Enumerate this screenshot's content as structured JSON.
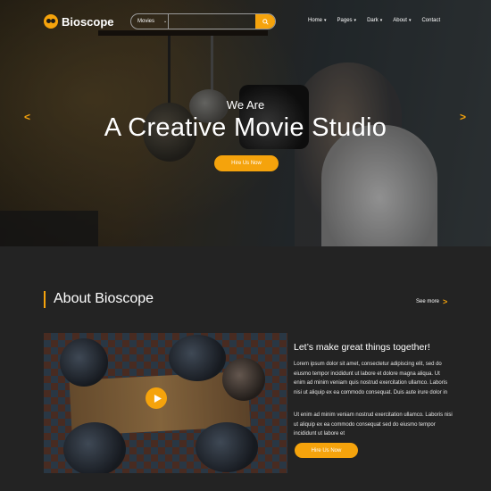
{
  "brand": {
    "name": "Bioscope",
    "logo_icon": "owl-eyes-icon",
    "accent": "#f5a30c"
  },
  "search": {
    "category": "Movies",
    "placeholder": "",
    "button_icon": "search-icon"
  },
  "nav": {
    "items": [
      {
        "label": "Home",
        "has_dropdown": true
      },
      {
        "label": "Pages",
        "has_dropdown": true
      },
      {
        "label": "Dark",
        "has_dropdown": true
      },
      {
        "label": "About",
        "has_dropdown": true
      },
      {
        "label": "Contact",
        "has_dropdown": false
      }
    ]
  },
  "hero": {
    "subtitle": "We Are",
    "title": "A Creative Movie Studio",
    "button_label": "Hire Us Now",
    "prev_icon": "chevron-left-icon",
    "next_icon": "chevron-right-icon"
  },
  "about": {
    "title": "About Bioscope",
    "see_more_label": "See more",
    "video_icon": "play-icon",
    "heading": "Let’s make great things together!",
    "paragraph1": "Lorem ipsum dolor sit amet, consectetur adipiscing elit, sed do eiusmo tempor incididunt ut labore et dolore magna aliqua. Ut enim ad minim veniam quis nostrud exercitation ullamco. Laboris nisi ut aliquip ex ea commodo consequat. Duis aute irure dolor in",
    "paragraph2": "Ut enim ad minim veniam nostrud exercitation ullamco. Laboris nisi ut aliquip ex ea commodo consequat sed do eiusmo tempor incididunt ut labore et",
    "button_label": "Hire Us Now"
  }
}
